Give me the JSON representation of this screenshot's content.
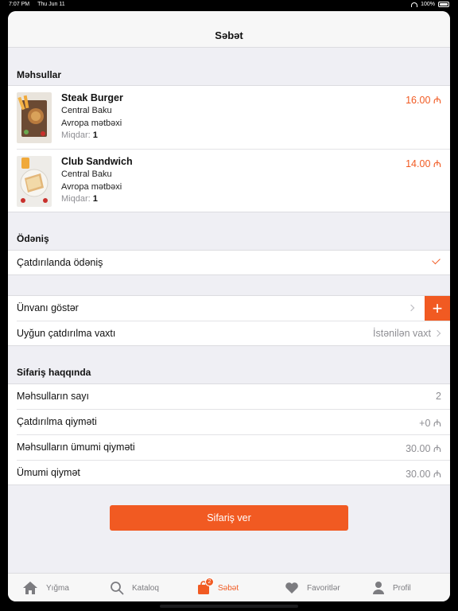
{
  "status": {
    "time": "7:07 PM",
    "date": "Thu Jun 11",
    "battery": "100%"
  },
  "nav": {
    "title": "Səbət"
  },
  "products_section": {
    "title": "Məhsullar",
    "items": [
      {
        "name": "Steak Burger",
        "restaurant": "Central Baku",
        "cuisine": "Avropa mətbəxi",
        "qty_label": "Miqdar:",
        "qty": "1",
        "price": "16.00 ₼"
      },
      {
        "name": "Club Sandwich",
        "restaurant": "Central Baku",
        "cuisine": "Avropa mətbəxi",
        "qty_label": "Miqdar:",
        "qty": "1",
        "price": "14.00 ₼"
      }
    ]
  },
  "payment": {
    "title": "Ödəniş",
    "method": "Çatdırılanda ödəniş"
  },
  "delivery": {
    "address_label": "Ünvanı göstər",
    "time_label": "Uyğun çatdırılma vaxtı",
    "time_value": "İstənilən vaxt"
  },
  "order_info": {
    "title": "Sifariş haqqında",
    "rows": [
      {
        "label": "Məhsulların sayı",
        "value": "2"
      },
      {
        "label": "Çatdırılma qiyməti",
        "value": "+0 ₼"
      },
      {
        "label": "Məhsulların ümumi qiyməti",
        "value": "30.00 ₼"
      },
      {
        "label": "Ümumi qiymət",
        "value": "30.00 ₼"
      }
    ]
  },
  "order_button": "Sifariş ver",
  "tabbar": {
    "items": [
      {
        "label": "Yığma",
        "icon": "home-icon"
      },
      {
        "label": "Kataloq",
        "icon": "search-icon"
      },
      {
        "label": "Səbət",
        "icon": "bag-icon",
        "badge": "2"
      },
      {
        "label": "Favoritlər",
        "icon": "heart-icon"
      },
      {
        "label": "Profil",
        "icon": "person-icon"
      }
    ]
  },
  "colors": {
    "accent": "#f15a22",
    "background": "#efeff4"
  }
}
